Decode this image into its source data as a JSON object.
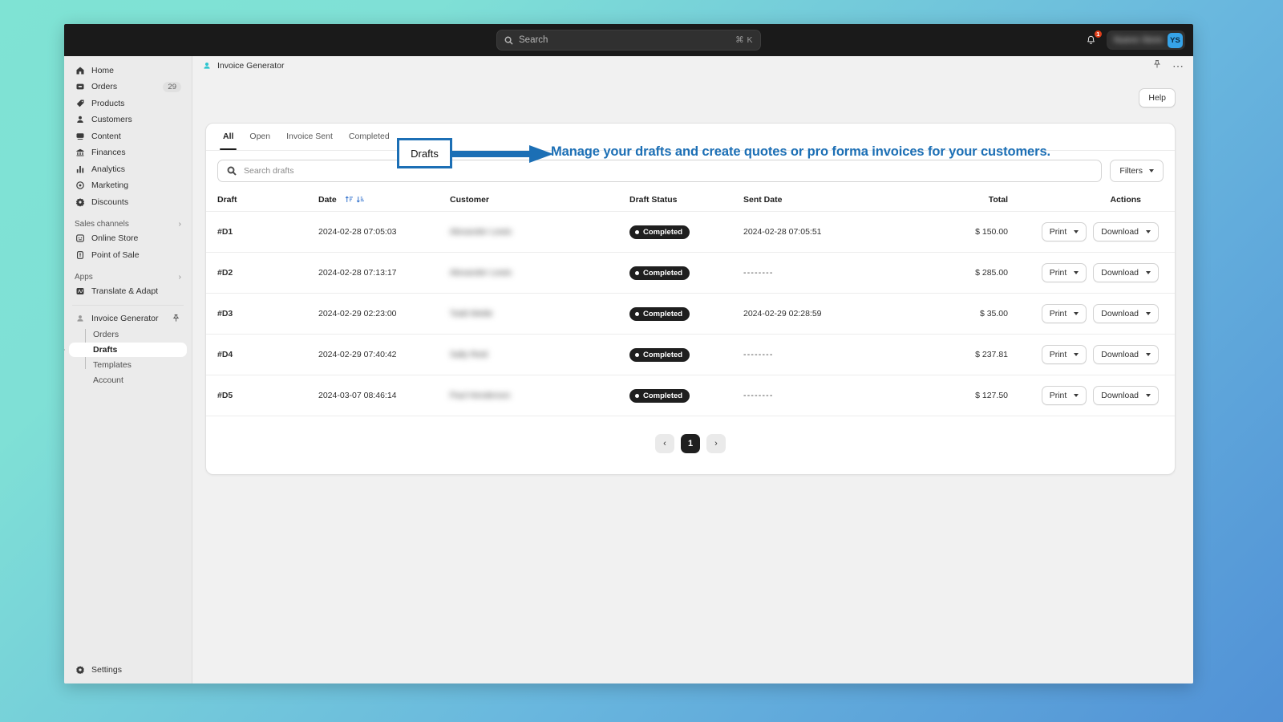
{
  "topbar": {
    "search_placeholder": "Search",
    "search_shortcut": "⌘ K",
    "notification_count": "1",
    "user_name": "Nuevo Store",
    "avatar_initials": "YS"
  },
  "sidebar": {
    "items": [
      {
        "label": "Home",
        "icon": "home-icon",
        "count": ""
      },
      {
        "label": "Orders",
        "icon": "orders-icon",
        "count": "29"
      },
      {
        "label": "Products",
        "icon": "products-icon",
        "count": ""
      },
      {
        "label": "Customers",
        "icon": "customers-icon",
        "count": ""
      },
      {
        "label": "Content",
        "icon": "content-icon",
        "count": ""
      },
      {
        "label": "Finances",
        "icon": "finances-icon",
        "count": ""
      },
      {
        "label": "Analytics",
        "icon": "analytics-icon",
        "count": ""
      },
      {
        "label": "Marketing",
        "icon": "marketing-icon",
        "count": ""
      },
      {
        "label": "Discounts",
        "icon": "discounts-icon",
        "count": ""
      }
    ],
    "sales_channels_header": "Sales channels",
    "sales_channels": [
      {
        "label": "Online Store",
        "icon": "online-store-icon"
      },
      {
        "label": "Point of Sale",
        "icon": "point-of-sale-icon"
      }
    ],
    "apps_header": "Apps",
    "apps": [
      {
        "label": "Translate & Adapt",
        "icon": "translate-adapt-icon"
      }
    ],
    "active_app": {
      "label": "Invoice Generator",
      "icon": "invoice-generator-icon",
      "pin_icon": "pin-icon"
    },
    "app_sub_items": [
      {
        "label": "Orders",
        "selected": false
      },
      {
        "label": "Drafts",
        "selected": true
      },
      {
        "label": "Templates",
        "selected": false
      },
      {
        "label": "Account",
        "selected": false
      }
    ],
    "settings_label": "Settings"
  },
  "breadcrumb": {
    "app_name": "Invoice Generator",
    "pin_icon": "pin-icon",
    "more_icon": "more-horizontal-icon"
  },
  "page": {
    "title": "Drafts",
    "help_label": "Help"
  },
  "annotation": {
    "callout_label": "Drafts",
    "text": "Manage your drafts and create quotes or pro forma invoices for your customers.",
    "color": "#1c6fb5"
  },
  "tabs": [
    {
      "label": "All",
      "active": true
    },
    {
      "label": "Open",
      "active": false
    },
    {
      "label": "Invoice Sent",
      "active": false
    },
    {
      "label": "Completed",
      "active": false
    }
  ],
  "toolbar": {
    "search_placeholder": "Search drafts",
    "search_value": "",
    "filters_label": "Filters"
  },
  "table": {
    "columns": [
      "Draft",
      "Date",
      "Customer",
      "Draft Status",
      "Sent Date",
      "Total",
      "Actions"
    ],
    "sort_icons": [
      "sort-ascending-icon",
      "sort-descending-icon"
    ],
    "rows": [
      {
        "draft": "#D1",
        "date": "2024-02-28 07:05:03",
        "customer": "Alexander Lewis",
        "status": "Completed",
        "sent_date": "2024-02-28 07:05:51",
        "total": "$ 150.00",
        "print": "Print",
        "download": "Download"
      },
      {
        "draft": "#D2",
        "date": "2024-02-28 07:13:17",
        "customer": "Alexander Lewis",
        "status": "Completed",
        "sent_date": "--------",
        "total": "$ 285.00",
        "print": "Print",
        "download": "Download"
      },
      {
        "draft": "#D3",
        "date": "2024-02-29 02:23:00",
        "customer": "Todd Webb",
        "status": "Completed",
        "sent_date": "2024-02-29 02:28:59",
        "total": "$ 35.00",
        "print": "Print",
        "download": "Download"
      },
      {
        "draft": "#D4",
        "date": "2024-02-29 07:40:42",
        "customer": "Sally Reid",
        "status": "Completed",
        "sent_date": "--------",
        "total": "$ 237.81",
        "print": "Print",
        "download": "Download"
      },
      {
        "draft": "#D5",
        "date": "2024-03-07 08:46:14",
        "customer": "Paul Henderson",
        "status": "Completed",
        "sent_date": "--------",
        "total": "$ 127.50",
        "print": "Print",
        "download": "Download"
      }
    ]
  },
  "pagination": {
    "prev": "‹",
    "next": "›",
    "current_page": "1"
  }
}
